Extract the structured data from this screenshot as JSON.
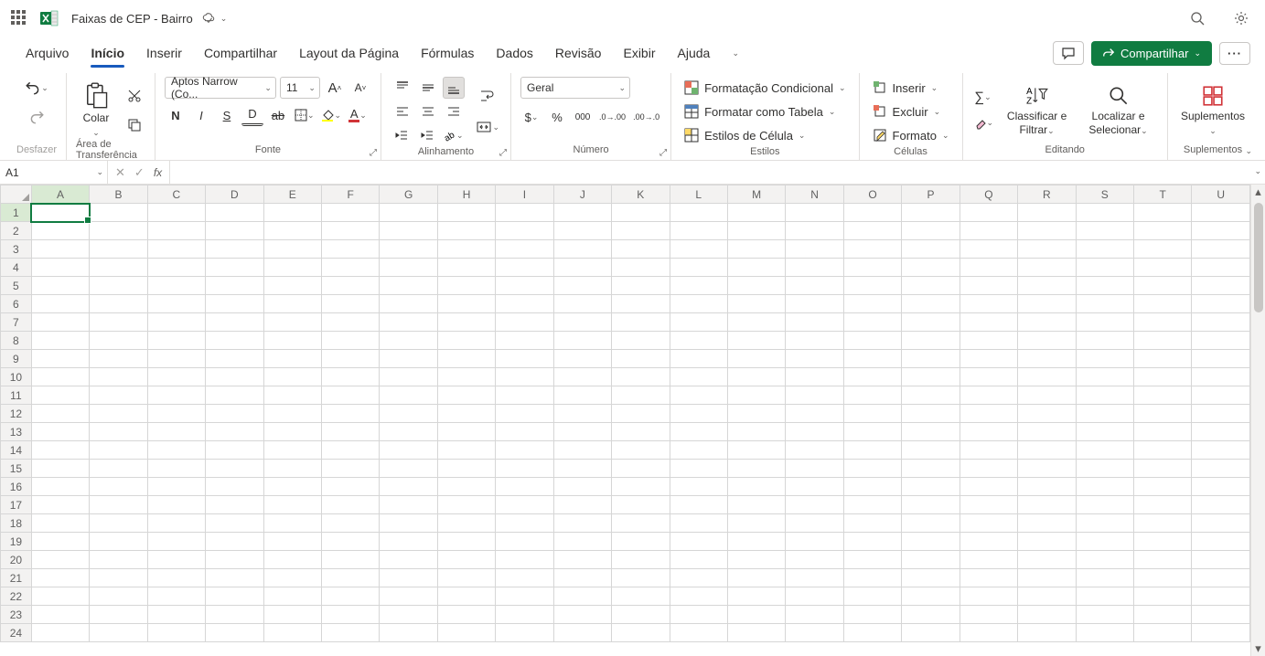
{
  "titlebar": {
    "doc_title": "Faixas de CEP - Bairro"
  },
  "menubar": {
    "tabs": [
      "Arquivo",
      "Início",
      "Inserir",
      "Compartilhar",
      "Layout da Página",
      "Fórmulas",
      "Dados",
      "Revisão",
      "Exibir",
      "Ajuda"
    ],
    "active_index": 1,
    "share_label": "Compartilhar"
  },
  "ribbon": {
    "undo_group": {
      "label": "Desfazer"
    },
    "clipboard": {
      "paste_label": "Colar",
      "label": "Área de Transferência"
    },
    "font": {
      "label": "Fonte",
      "font_name": "Aptos Narrow (Co...",
      "font_size": "11",
      "bold": "N",
      "italic": "I",
      "underline": "S",
      "double_underline": "D"
    },
    "alignment": {
      "label": "Alinhamento"
    },
    "number": {
      "label": "Número",
      "format": "Geral"
    },
    "styles": {
      "label": "Estilos",
      "cond_format": "Formatação Condicional",
      "as_table": "Formatar como Tabela",
      "cell_styles": "Estilos de Célula"
    },
    "cells": {
      "label": "Células",
      "insert": "Inserir",
      "delete": "Excluir",
      "format": "Formato"
    },
    "editing": {
      "label": "Editando",
      "sort_filter": "Classificar e Filtrar",
      "find_select": "Localizar e Selecionar"
    },
    "addins": {
      "label": "Suplementos",
      "button": "Suplementos"
    }
  },
  "formula_bar": {
    "name_box": "A1",
    "formula": ""
  },
  "grid": {
    "columns": [
      "A",
      "B",
      "C",
      "D",
      "E",
      "F",
      "G",
      "H",
      "I",
      "J",
      "K",
      "L",
      "M",
      "N",
      "O",
      "P",
      "Q",
      "R",
      "S",
      "T",
      "U"
    ],
    "rows": [
      1,
      2,
      3,
      4,
      5,
      6,
      7,
      8,
      9,
      10,
      11,
      12,
      13,
      14,
      15,
      16,
      17,
      18,
      19,
      20,
      21,
      22,
      23,
      24
    ],
    "active_cell": "A1"
  }
}
